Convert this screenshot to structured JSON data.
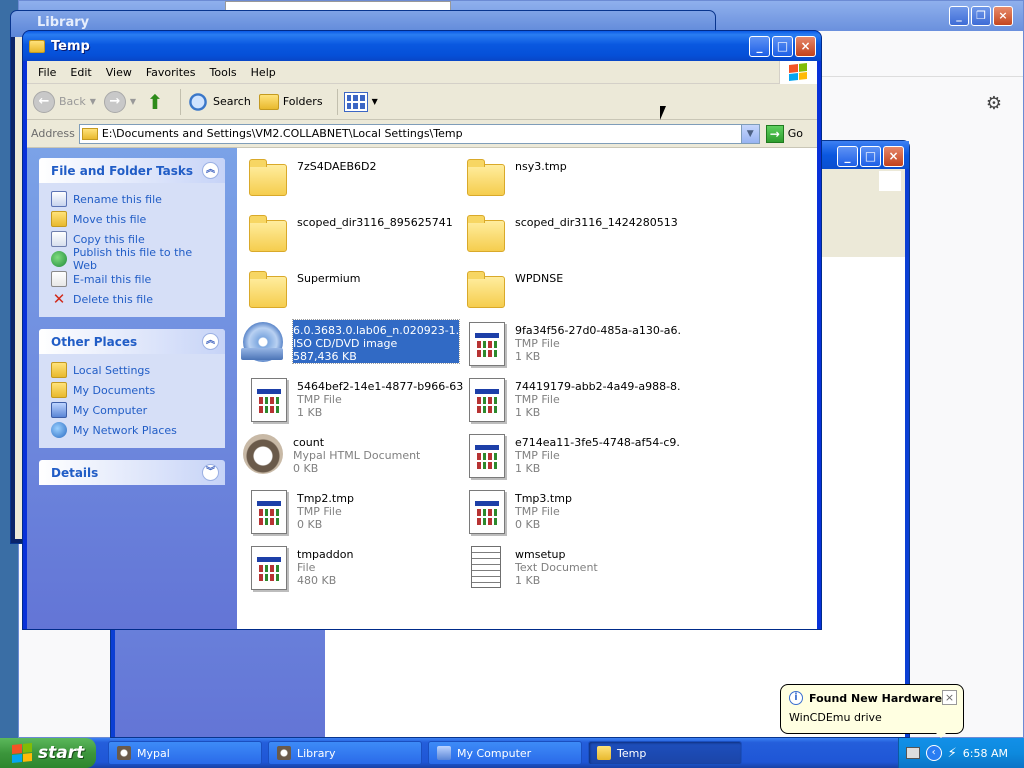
{
  "bg_library": {
    "title": "Library"
  },
  "bg_mycomputer": {
    "go_label": "Go"
  },
  "window": {
    "title": "Temp",
    "menu": [
      "File",
      "Edit",
      "View",
      "Favorites",
      "Tools",
      "Help"
    ],
    "toolbar": {
      "back": "Back",
      "search": "Search",
      "folders": "Folders"
    },
    "address": {
      "label": "Address",
      "value": "E:\\Documents and Settings\\VM2.COLLABNET\\Local Settings\\Temp",
      "go": "Go"
    }
  },
  "tasks_panel": {
    "title": "File and Folder Tasks",
    "items": [
      "Rename this file",
      "Move this file",
      "Copy this file",
      "Publish this file to the Web",
      "E-mail this file",
      "Delete this file"
    ]
  },
  "places_panel": {
    "title": "Other Places",
    "items": [
      "Local Settings",
      "My Documents",
      "My Computer",
      "My Network Places"
    ]
  },
  "details_panel": {
    "title": "Details"
  },
  "files": [
    {
      "name": "7zS4DAEB6D2",
      "type": "",
      "size": "",
      "icon": "folder-icon"
    },
    {
      "name": "nsy3.tmp",
      "type": "",
      "size": "",
      "icon": "folder-icon"
    },
    {
      "name": "scoped_dir3116_895625741",
      "type": "",
      "size": "",
      "icon": "folder-icon"
    },
    {
      "name": "scoped_dir3116_1424280513",
      "type": "",
      "size": "",
      "icon": "folder-icon"
    },
    {
      "name": "Supermium",
      "type": "",
      "size": "",
      "icon": "folder-icon"
    },
    {
      "name": "WPDNSE",
      "type": "",
      "size": "",
      "icon": "folder-icon"
    },
    {
      "name": "6.0.3683.0.lab06_n.020923-1...",
      "type": "ISO CD/DVD image",
      "size": "587,436 KB",
      "icon": "disc-image-icon"
    },
    {
      "name": "9fa34f56-27d0-485a-a130-a6...",
      "type": "TMP File",
      "size": "1 KB",
      "icon": "tmp-file-icon"
    },
    {
      "name": "5464bef2-14e1-4877-b966-63...",
      "type": "TMP File",
      "size": "1 KB",
      "icon": "tmp-file-icon"
    },
    {
      "name": "74419179-abb2-4a49-a988-8...",
      "type": "TMP File",
      "size": "1 KB",
      "icon": "tmp-file-icon"
    },
    {
      "name": "count",
      "type": "Mypal HTML Document",
      "size": "0 KB",
      "icon": "mypal-document-icon"
    },
    {
      "name": "e714ea11-3fe5-4748-af54-c9...",
      "type": "TMP File",
      "size": "1 KB",
      "icon": "tmp-file-icon"
    },
    {
      "name": "Tmp2.tmp",
      "type": "TMP File",
      "size": "0 KB",
      "icon": "tmp-file-icon"
    },
    {
      "name": "Tmp3.tmp",
      "type": "TMP File",
      "size": "0 KB",
      "icon": "tmp-file-icon"
    },
    {
      "name": "tmpaddon",
      "type": "File",
      "size": "480 KB",
      "icon": "tmp-file-icon"
    },
    {
      "name": "wmsetup",
      "type": "Text Document",
      "size": "1 KB",
      "icon": "text-document-icon"
    }
  ],
  "taskbar": {
    "start": "start",
    "tasks": [
      "Mypal",
      "Library",
      "My Computer",
      "Temp"
    ],
    "clock": "6:58 AM"
  },
  "balloon": {
    "title": "Found New Hardware",
    "message": "WinCDEmu drive"
  },
  "colors": {
    "xp_blue": "#0a58e0",
    "task_link": "#215dc6",
    "selection": "#316ac5"
  }
}
